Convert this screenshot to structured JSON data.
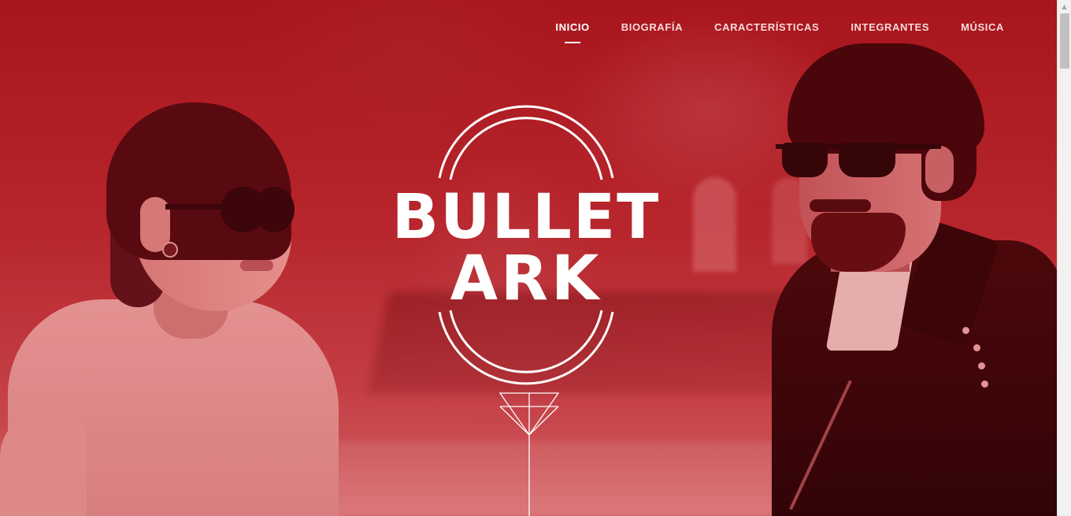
{
  "nav": {
    "items": [
      {
        "label": "INICIO",
        "active": true
      },
      {
        "label": "BIOGRAFÍA",
        "active": false
      },
      {
        "label": "CARACTERÍSTICAS",
        "active": false
      },
      {
        "label": "INTEGRANTES",
        "active": false
      },
      {
        "label": "MÚSICA",
        "active": false
      }
    ]
  },
  "logo": {
    "line1": "BULLET",
    "line2": "ARK"
  },
  "theme": {
    "overlay_color": "#b3161d",
    "text_color": "#ffffff"
  },
  "icons": {
    "scroll_down": "triangle-arrow-down-icon",
    "scroll_up": "scroll-up-arrow-icon"
  }
}
